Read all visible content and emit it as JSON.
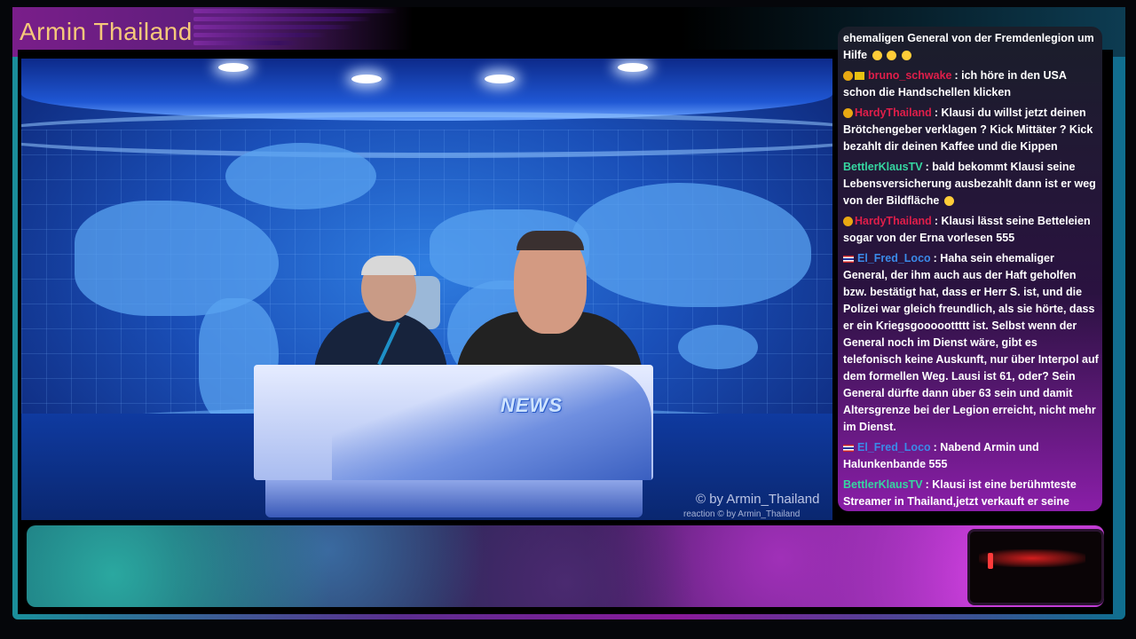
{
  "header": {
    "title": "Armin Thailand"
  },
  "studio": {
    "desk_label": "NEWS",
    "watermark": "© by Armin_Thailand",
    "watermark_small": "reaction  © by Armin_Thailand"
  },
  "chat": {
    "messages": [
      {
        "user": "",
        "text": "ehemaligen General von der Fremdenlegion um Hilfe",
        "emojis": 3
      },
      {
        "user": "bruno_schwake",
        "text": ": ich höre in den USA schon die Handschellen klicken",
        "color": "red"
      },
      {
        "user": "HardyThailand",
        "text": ": Klausi du willst jetzt deinen Brötchengeber verklagen ? Kick Mittäter ? Kick bezahlt dir deinen Kaffee und die Kippen",
        "color": "red"
      },
      {
        "user": "BettlerKlausTV",
        "text": ": bald bekommt Klausi seine Lebensversicherung ausbezahlt dann ist er weg von der Bildfläche",
        "color": "green"
      },
      {
        "user": "HardyThailand",
        "text": ": Klausi lässt seine Betteleien sogar von der Erna vorlesen 555",
        "color": "red"
      },
      {
        "user": "El_Fred_Loco",
        "text": ": Haha sein ehemaliger General, der ihm auch aus der Haft geholfen bzw. bestätigt hat, dass er Herr S. ist, und die Polizei war gleich freundlich, als sie hörte, dass er ein Kriegsgooooottttt ist. Selbst wenn der General noch im Dienst wäre, gibt es telefonisch keine Auskunft, nur über Interpol auf dem formellen Weg. Lausi ist 61, oder? Sein General dürfte dann über 63 sein und damit Altersgrenze bei der Legion erreicht, nicht mehr im Dienst.",
        "color": "blue"
      },
      {
        "user": "El_Fred_Loco",
        "text": ": Nabend Armin und Halunkenbande 555",
        "color": "blue"
      },
      {
        "user": "BettlerKlausTV",
        "text": ": Klausi ist eine berühmteste Streamer in Thailand,jetzt verkauft er seine Kappe mit Schweißrand",
        "color": "green"
      }
    ]
  },
  "colors": {
    "title": "#f5c87a",
    "user_red": "#e01e4a",
    "user_green": "#36d6a0",
    "user_blue": "#3a8ae8"
  }
}
